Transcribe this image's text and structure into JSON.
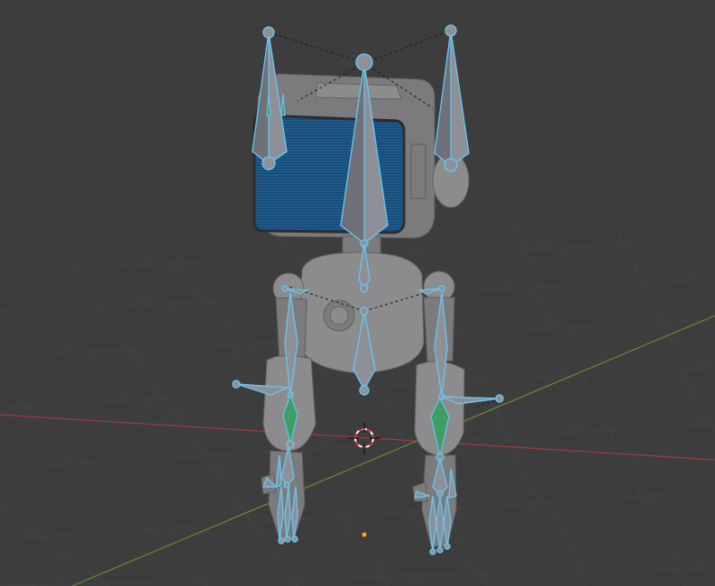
{
  "viewport": {
    "background": "#3d3d3d",
    "grid_color": "#444444",
    "x_axis_color": "#9c3b40",
    "y_axis_color": "#6c8a2e",
    "bone_outline_color": "#6ac2ec",
    "bone_fill_color": "#8d9097",
    "selected_bone_color": "#3f9e63",
    "screen_color": "#1f5a8c",
    "origin_color": "#f5a623"
  },
  "scene": {
    "object": "robot-character-mesh",
    "armature": "robot-rig",
    "icons": {
      "cursor": "3d-cursor-icon",
      "origin": "origin-point-icon"
    }
  }
}
